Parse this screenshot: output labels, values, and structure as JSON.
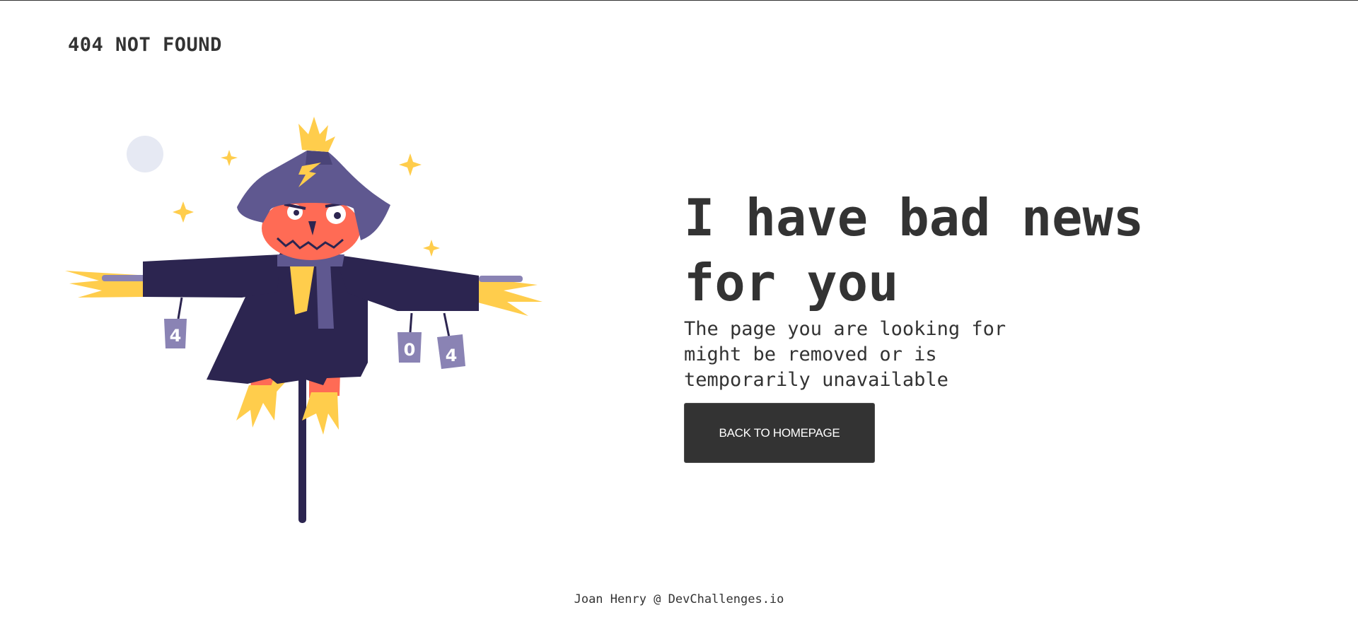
{
  "header": {
    "brand": "404 NOT FOUND"
  },
  "illustration": {
    "subject": "scarecrow",
    "can_labels": [
      "4",
      "0",
      "4"
    ]
  },
  "main": {
    "headline": "I have bad news for you",
    "message": "The page you are looking for might be removed or is temporarily unavailable",
    "button_label": "BACK TO HOMEPAGE"
  },
  "footer": {
    "credit": "Joan Henry @ DevChallenges.io"
  },
  "colors": {
    "text": "#333333",
    "button_bg": "#333333",
    "button_text": "#ffffff",
    "hat": "#5f5890",
    "coat": "#2c2550",
    "pumpkin": "#ff6b55",
    "straw": "#ffcd4c",
    "can": "#8a83b4"
  }
}
